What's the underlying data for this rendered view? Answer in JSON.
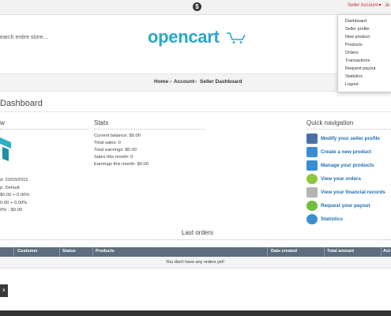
{
  "topbar": {
    "currency_symbol": "$",
    "seller_account_label": "Seller Account",
    "user_name_truncated": "Je"
  },
  "header": {
    "search_placeholder": "earch entire store...",
    "logo_text": "opencart"
  },
  "seller_menu": {
    "items": [
      "Dashboard",
      "Seller profile",
      "New product",
      "Products",
      "Orders",
      "Transactions",
      "Request payout",
      "Statistics",
      "Logout"
    ]
  },
  "breadcrumb": {
    "items": [
      "Home",
      "Account",
      "Seller Dashboard"
    ],
    "separator": "»"
  },
  "page": {
    "title": "Dashboard"
  },
  "overview": {
    "heading_partial": "w",
    "lines": [
      "d: 23/03/2015",
      "p: Default",
      "$0.00 + 0.00%",
      "0.00 + 0.00%",
      "0% - $0.00"
    ]
  },
  "stats": {
    "heading": "Stats",
    "lines": [
      "Current balance: $0.00",
      "Total sales: 0",
      "Total earnings: $0.00",
      "Sales this month: 0",
      "Earnings this month: $0.00"
    ]
  },
  "quick_nav": {
    "heading": "Quick navigation",
    "items": [
      {
        "label": "Modify your seller profile",
        "icon": "user-profile-icon",
        "color": "#4a6fa5"
      },
      {
        "label": "Create a new product",
        "icon": "new-product-icon",
        "color": "#3b8dd0"
      },
      {
        "label": "Manage your products",
        "icon": "manage-products-icon",
        "color": "#3b8dd0"
      },
      {
        "label": "View your orders",
        "icon": "orders-icon",
        "color": "#8cc63f"
      },
      {
        "label": "View your financial records",
        "icon": "financial-records-icon",
        "color": "#9e9e9e"
      },
      {
        "label": "Request your payout",
        "icon": "payout-icon",
        "color": "#6fbf3f"
      },
      {
        "label": "Statistics",
        "icon": "statistics-icon",
        "color": "#3b8dd0"
      }
    ]
  },
  "last_orders": {
    "title": "Last orders",
    "columns": [
      "Customer",
      "Status",
      "Products",
      "Date created",
      "Total amount",
      "Act"
    ],
    "empty_message": "You don't have any orders yet!"
  },
  "back_button": {
    "label": "k"
  },
  "colors": {
    "accent": "#c0392b",
    "link": "#1f6fb2",
    "logo": "#2ba6cb",
    "table_header": "#5d6d7e"
  }
}
